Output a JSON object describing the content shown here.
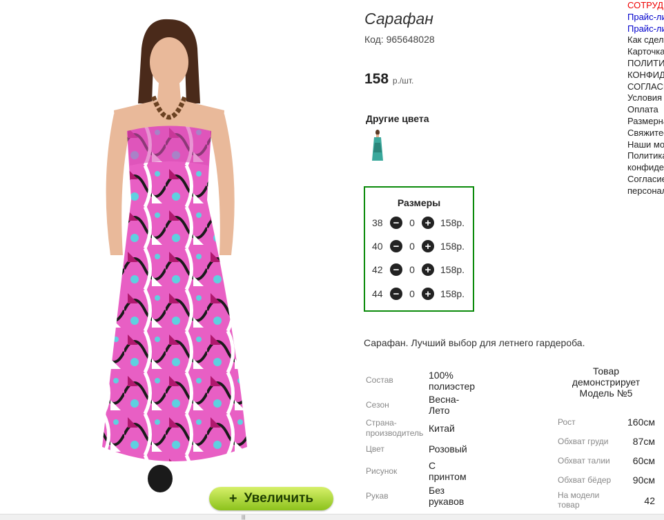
{
  "product": {
    "title": "Сарафан",
    "code": "Код: 965648028",
    "price": "158",
    "price_unit": "р./шт.",
    "other_colors_label": "Другие цвета",
    "zoom_button": "Увеличить",
    "zoom_icon": "+",
    "description": "Сарафан. Лучший выбор для летнего гардероба."
  },
  "sizes": {
    "title": "Размеры",
    "rows": [
      {
        "size": "38",
        "qty": "0",
        "price": "158р."
      },
      {
        "size": "40",
        "qty": "0",
        "price": "158р."
      },
      {
        "size": "42",
        "qty": "0",
        "price": "158р."
      },
      {
        "size": "44",
        "qty": "0",
        "price": "158р."
      }
    ],
    "minus_icon": "−",
    "plus_icon": "+"
  },
  "specs": [
    {
      "label": "Состав",
      "value": "100% полиэстер"
    },
    {
      "label": "Сезон",
      "value": "Весна-Лето"
    },
    {
      "label": "Страна-производитель",
      "value": "Китай"
    },
    {
      "label": "Цвет",
      "value": "Розовый"
    },
    {
      "label": "Рисунок",
      "value": "С принтом"
    },
    {
      "label": "Рукав",
      "value": "Без рукавов"
    }
  ],
  "model": {
    "heading": "Товар демонстрирует Модель №5",
    "rows": [
      {
        "label": "Рост",
        "value": "160см"
      },
      {
        "label": "Обхват груди",
        "value": "87см"
      },
      {
        "label": "Обхват талии",
        "value": "60см"
      },
      {
        "label": "Обхват бёдер",
        "value": "90см"
      },
      {
        "label": "На модели товар",
        "value": "42"
      }
    ]
  },
  "right_links": [
    {
      "text": "СОТРУДНИЧЕСТВО",
      "style": "red"
    },
    {
      "text": "Прайс-лист",
      "style": "blue"
    },
    {
      "text": "Прайс-лист",
      "style": "blue"
    },
    {
      "text": "Как сделать заказ",
      "style": ""
    },
    {
      "text": "Карточка",
      "style": ""
    },
    {
      "text": "ПОЛИТИКА",
      "style": ""
    },
    {
      "text": "КОНФИДЕНЦИАЛЬНОСТИ",
      "style": ""
    },
    {
      "text": "СОГЛАСИЕ",
      "style": ""
    },
    {
      "text": "Условия",
      "style": ""
    },
    {
      "text": "Оплата",
      "style": ""
    },
    {
      "text": "Размерная сетка",
      "style": ""
    },
    {
      "text": "Свяжитесь",
      "style": ""
    },
    {
      "text": "Наши модели",
      "style": ""
    },
    {
      "text": "Политика",
      "style": ""
    },
    {
      "text": "конфиденциальности",
      "style": ""
    },
    {
      "text": "Согласие",
      "style": ""
    },
    {
      "text": "персональных",
      "style": ""
    }
  ],
  "colors": {
    "accent": "#0a8a0a",
    "zoom_button": "#a6d82c",
    "dress_pink": "#e85fc4"
  }
}
